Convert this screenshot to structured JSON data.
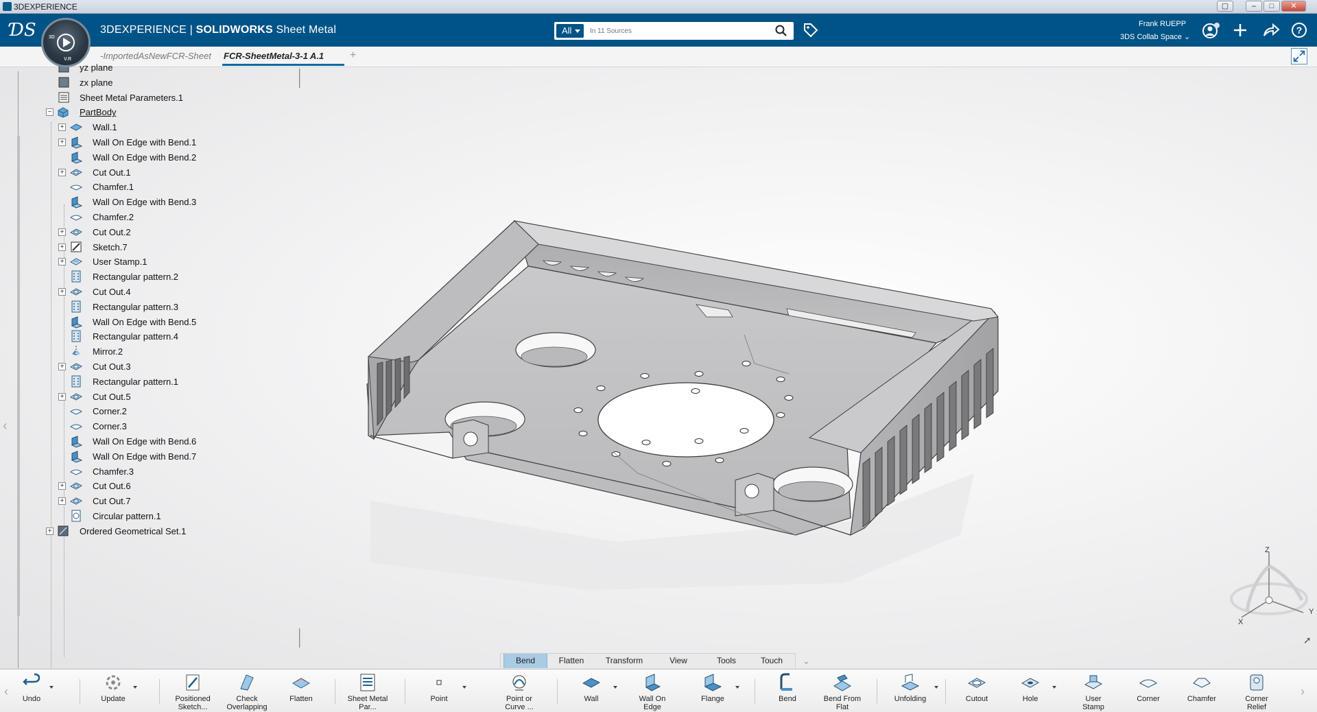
{
  "window": {
    "title": "3DEXPERIENCE"
  },
  "header": {
    "app_title_prefix": "3DEXPERIENCE | ",
    "app_title_brand": "SOLIDWORKS",
    "app_title_suffix": " Sheet Metal",
    "compass_labels": {
      "top": "3D",
      "bottom": "V.R"
    },
    "search": {
      "scope": "All",
      "placeholder": "In 11 Sources"
    },
    "user": {
      "name": "Frank RUEPP",
      "space": "3DS Collab Space"
    },
    "brand_color": "#005386"
  },
  "tabs": [
    {
      "label": "-ImportedAsNewFCR-Sheet",
      "active": false
    },
    {
      "label": "FCR-SheetMetal-3-1 A.1",
      "active": true
    }
  ],
  "tree": {
    "items": [
      {
        "label": "yz plane",
        "icon": "plane-icon",
        "level": 1,
        "expander": false
      },
      {
        "label": "zx plane",
        "icon": "plane-icon",
        "level": 1,
        "expander": false
      },
      {
        "label": "Sheet Metal Parameters.1",
        "icon": "parameters-icon",
        "level": 1,
        "expander": false
      },
      {
        "label": "PartBody",
        "icon": "partbody-icon",
        "level": 0,
        "expander": "minus"
      },
      {
        "label": "Wall.1",
        "icon": "wall-icon",
        "level": 2,
        "expander": "plus"
      },
      {
        "label": "Wall On Edge with Bend.1",
        "icon": "wall-on-edge-icon",
        "level": 2,
        "expander": "plus"
      },
      {
        "label": "Wall On Edge with Bend.2",
        "icon": "wall-on-edge-icon",
        "level": 2,
        "expander": false
      },
      {
        "label": "Cut Out.1",
        "icon": "cutout-icon",
        "level": 2,
        "expander": "plus"
      },
      {
        "label": "Chamfer.1",
        "icon": "chamfer-icon",
        "level": 2,
        "expander": false
      },
      {
        "label": "Wall On Edge with Bend.3",
        "icon": "wall-on-edge-icon",
        "level": 2,
        "expander": false
      },
      {
        "label": "Chamfer.2",
        "icon": "chamfer-icon",
        "level": 2,
        "expander": false
      },
      {
        "label": "Cut Out.2",
        "icon": "cutout-icon",
        "level": 2,
        "expander": "plus"
      },
      {
        "label": "Sketch.7",
        "icon": "sketch-icon",
        "level": 2,
        "expander": "plus"
      },
      {
        "label": "User Stamp.1",
        "icon": "user-stamp-icon",
        "level": 2,
        "expander": "plus"
      },
      {
        "label": "Rectangular pattern.2",
        "icon": "rect-pattern-icon",
        "level": 2,
        "expander": false
      },
      {
        "label": "Cut Out.4",
        "icon": "cutout-icon",
        "level": 2,
        "expander": "plus"
      },
      {
        "label": "Rectangular pattern.3",
        "icon": "rect-pattern-icon",
        "level": 2,
        "expander": false
      },
      {
        "label": "Wall On Edge with Bend.5",
        "icon": "wall-on-edge-icon",
        "level": 2,
        "expander": false
      },
      {
        "label": "Rectangular pattern.4",
        "icon": "rect-pattern-icon",
        "level": 2,
        "expander": false
      },
      {
        "label": "Mirror.2",
        "icon": "mirror-icon",
        "level": 2,
        "expander": false
      },
      {
        "label": "Cut Out.3",
        "icon": "cutout-icon",
        "level": 2,
        "expander": "plus"
      },
      {
        "label": "Rectangular pattern.1",
        "icon": "rect-pattern-icon",
        "level": 2,
        "expander": false
      },
      {
        "label": "Cut Out.5",
        "icon": "cutout-icon",
        "level": 2,
        "expander": "plus"
      },
      {
        "label": "Corner.2",
        "icon": "corner-icon",
        "level": 2,
        "expander": false
      },
      {
        "label": "Corner.3",
        "icon": "corner-icon",
        "level": 2,
        "expander": false
      },
      {
        "label": "Wall On Edge with Bend.6",
        "icon": "wall-on-edge-icon",
        "level": 2,
        "expander": false
      },
      {
        "label": "Wall On Edge with Bend.7",
        "icon": "wall-on-edge-icon",
        "level": 2,
        "expander": false
      },
      {
        "label": "Chamfer.3",
        "icon": "chamfer-icon",
        "level": 2,
        "expander": false
      },
      {
        "label": "Cut Out.6",
        "icon": "cutout-icon",
        "level": 2,
        "expander": "plus"
      },
      {
        "label": "Cut Out.7",
        "icon": "cutout-icon",
        "level": 2,
        "expander": "plus"
      },
      {
        "label": "Circular pattern.1",
        "icon": "circular-pattern-icon",
        "level": 2,
        "expander": false
      },
      {
        "label": "Ordered Geometrical Set.1",
        "icon": "geometrical-set-icon",
        "level": 0,
        "expander": "plus"
      }
    ]
  },
  "compass_axes": {
    "z": "Z",
    "x": "X",
    "y": "Y"
  },
  "section_tabs": [
    "Bend",
    "Flatten",
    "Transform",
    "View",
    "Tools",
    "Touch"
  ],
  "section_tabs_active": "Bend",
  "action_bar": [
    {
      "id": "undo",
      "label": "Undo",
      "icon": "undo-icon",
      "dropdown": true
    },
    {
      "id": "update",
      "label": "Update",
      "icon": "update-icon",
      "dropdown": true
    },
    {
      "id": "positioned-sketch",
      "label": "Positioned Sketch...",
      "icon": "positioned-sketch-icon",
      "dropdown": false
    },
    {
      "id": "check-overlapping",
      "label": "Check Overlapping",
      "icon": "check-overlapping-icon",
      "dropdown": false
    },
    {
      "id": "flatten",
      "label": "Flatten",
      "icon": "flatten-icon",
      "dropdown": false
    },
    {
      "id": "sheet-metal-parameters",
      "label": "Sheet Metal Par...",
      "icon": "sheet-metal-parameters-icon",
      "dropdown": false
    },
    {
      "id": "point",
      "label": "Point",
      "icon": "point-icon",
      "dropdown": true
    },
    {
      "id": "point-or-curve",
      "label": "Point or Curve ...",
      "icon": "point-or-curve-icon",
      "dropdown": false
    },
    {
      "id": "wall",
      "label": "Wall",
      "icon": "wall-icon",
      "dropdown": true
    },
    {
      "id": "wall-on-edge",
      "label": "Wall On Edge",
      "icon": "wall-on-edge-icon",
      "dropdown": false
    },
    {
      "id": "flange",
      "label": "Flange",
      "icon": "flange-icon",
      "dropdown": true
    },
    {
      "id": "bend",
      "label": "Bend",
      "icon": "bend-icon",
      "dropdown": false
    },
    {
      "id": "bend-from-flat",
      "label": "Bend From Flat",
      "icon": "bend-from-flat-icon",
      "dropdown": false
    },
    {
      "id": "unfolding",
      "label": "Unfolding",
      "icon": "unfolding-icon",
      "dropdown": true
    },
    {
      "id": "cutout",
      "label": "Cutout",
      "icon": "cutout-icon",
      "dropdown": false
    },
    {
      "id": "hole",
      "label": "Hole",
      "icon": "hole-icon",
      "dropdown": true
    },
    {
      "id": "user-stamp",
      "label": "User Stamp",
      "icon": "user-stamp-icon",
      "dropdown": false
    },
    {
      "id": "corner",
      "label": "Corner",
      "icon": "corner-icon",
      "dropdown": false
    },
    {
      "id": "chamfer",
      "label": "Chamfer",
      "icon": "chamfer-icon",
      "dropdown": false
    },
    {
      "id": "corner-relief",
      "label": "Corner Relief",
      "icon": "corner-relief-icon",
      "dropdown": false
    }
  ]
}
